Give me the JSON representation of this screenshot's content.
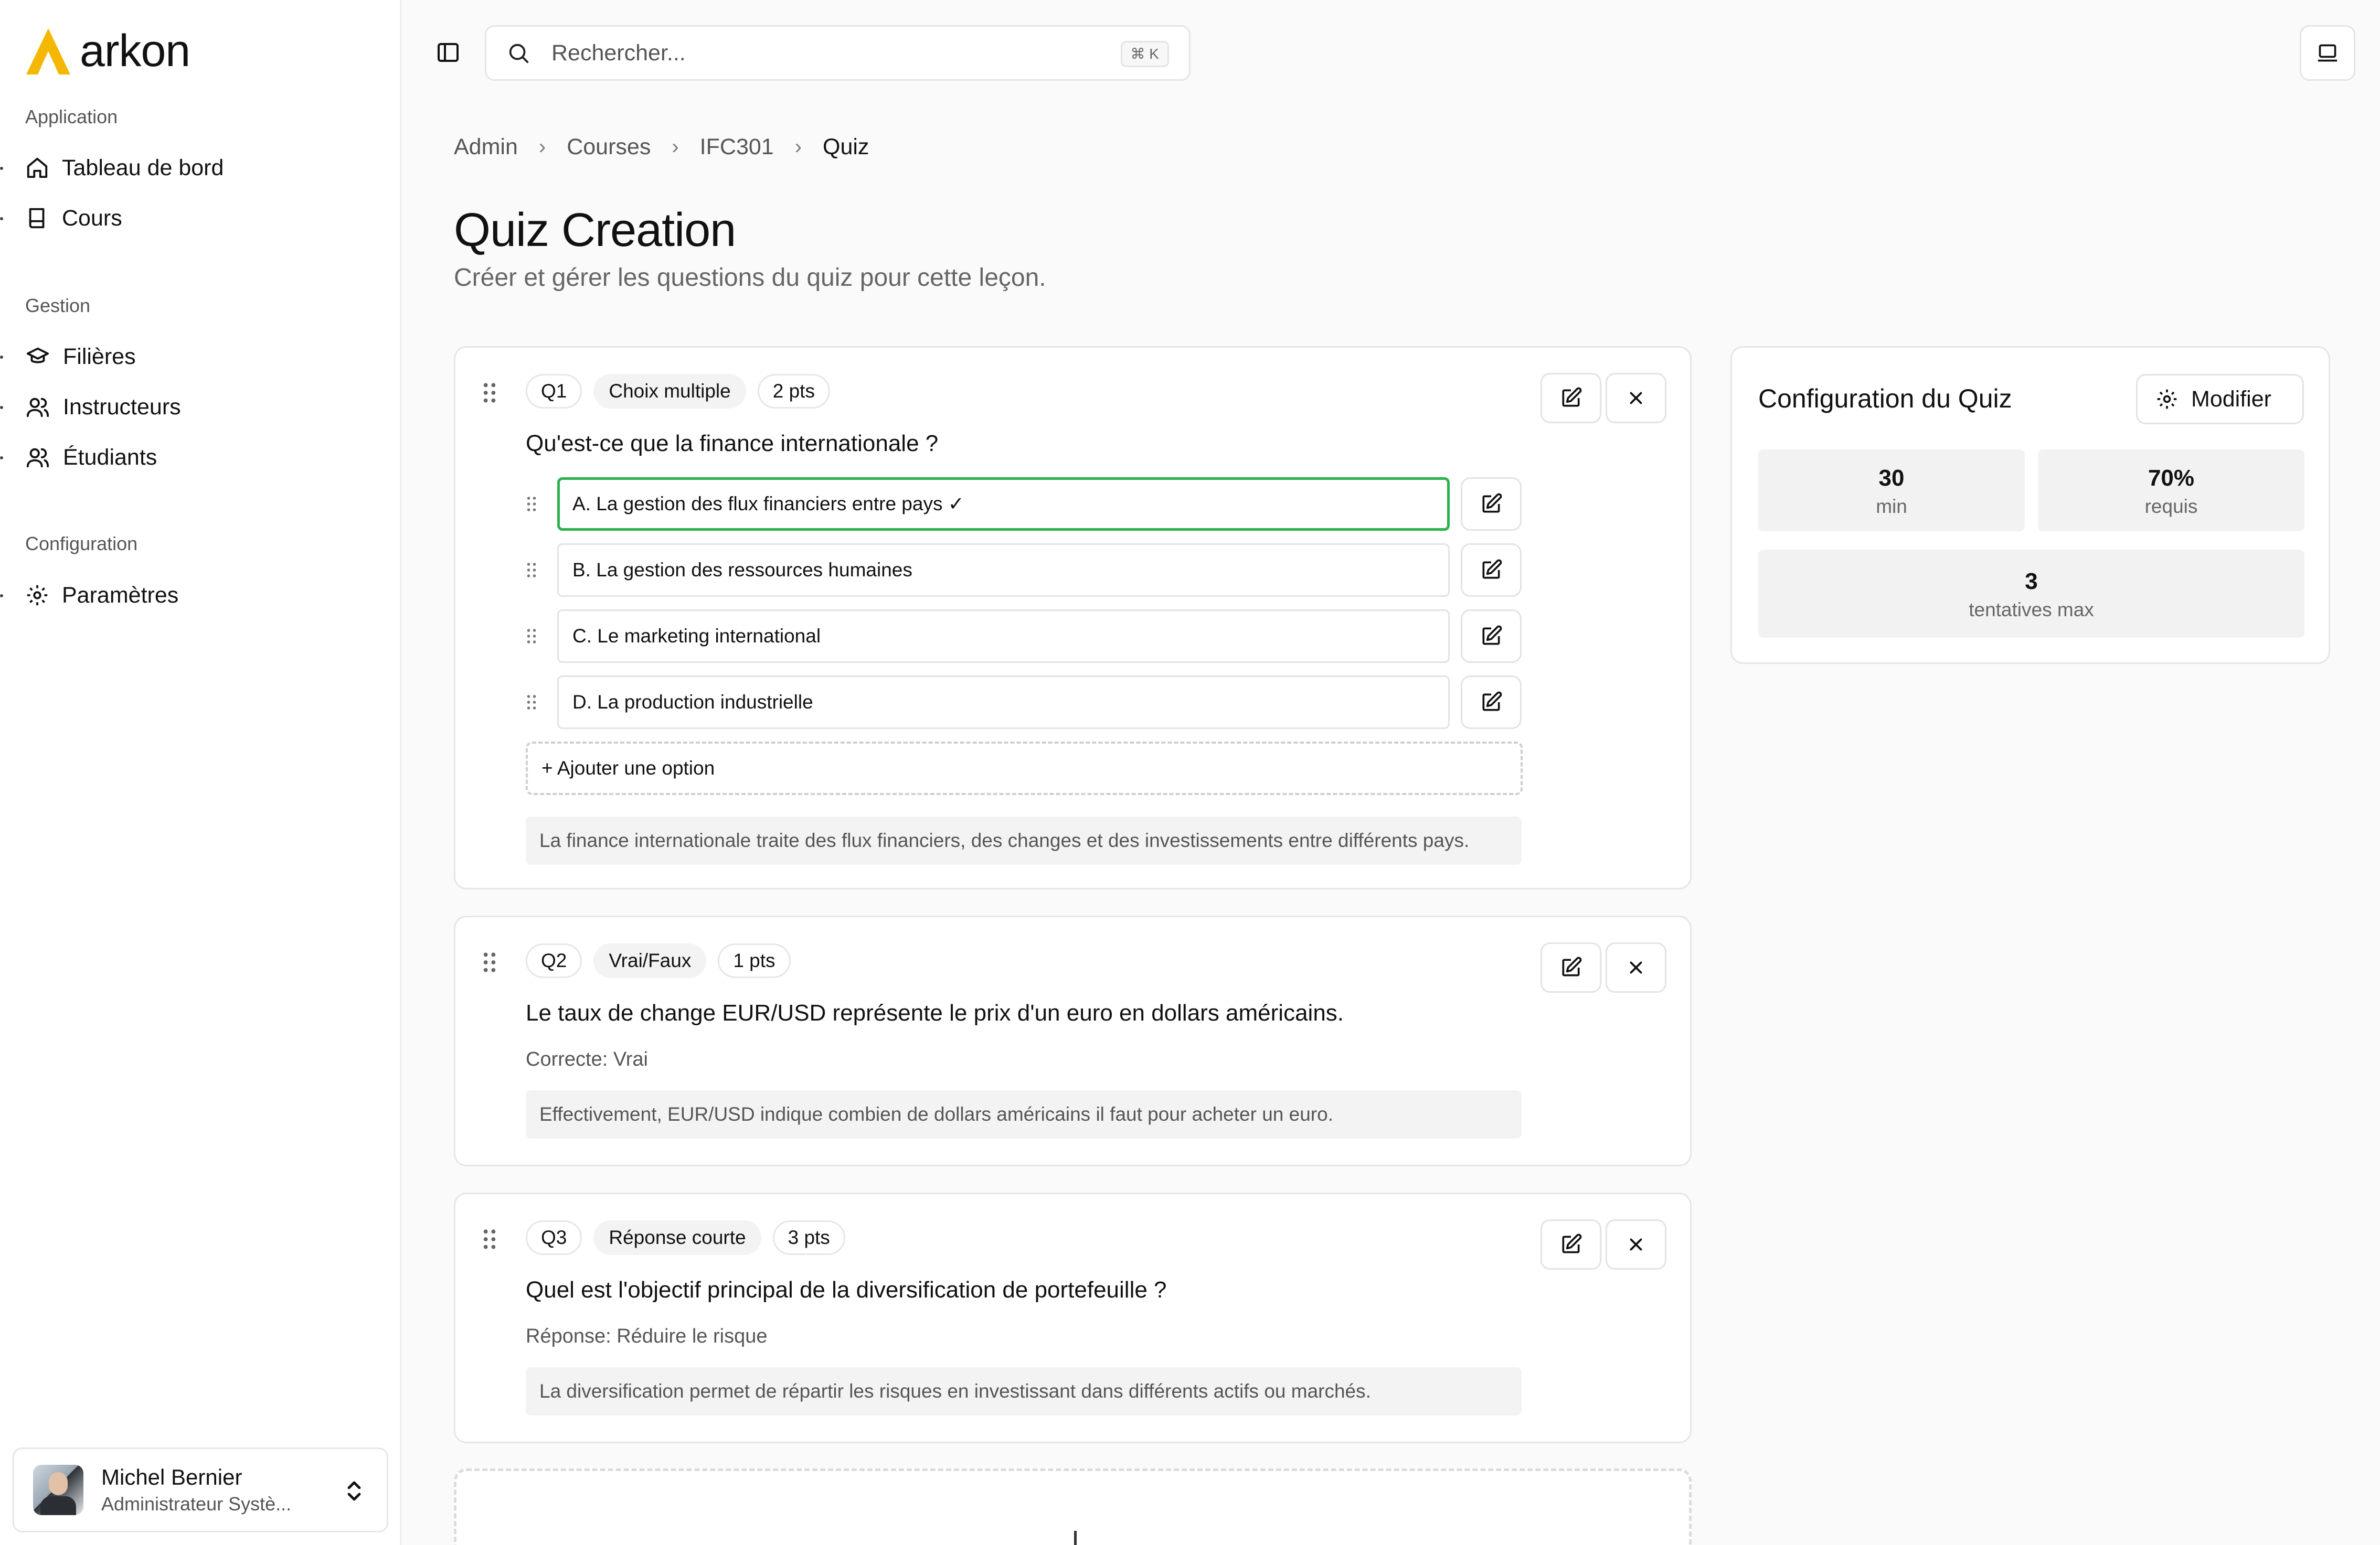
{
  "app": {
    "logo_text": "arkon",
    "brand_color": "#F5B800"
  },
  "sidebar": {
    "sections": [
      {
        "title": "Application",
        "items": [
          {
            "label": "Tableau de bord",
            "icon": "home-icon"
          },
          {
            "label": "Cours",
            "icon": "book-icon"
          }
        ]
      },
      {
        "title": "Gestion",
        "items": [
          {
            "label": "Filières",
            "icon": "graduation-cap-icon"
          },
          {
            "label": "Instructeurs",
            "icon": "users-icon"
          },
          {
            "label": "Étudiants",
            "icon": "users-icon"
          }
        ]
      },
      {
        "title": "Configuration",
        "items": [
          {
            "label": "Paramètres",
            "icon": "gear-icon"
          }
        ]
      }
    ],
    "user": {
      "name": "Michel Bernier",
      "role": "Administrateur Systè..."
    }
  },
  "search": {
    "placeholder": "Rechercher...",
    "shortcut": "⌘ K"
  },
  "breadcrumb": [
    "Admin",
    "Courses",
    "IFC301",
    "Quiz"
  ],
  "page": {
    "title": "Quiz Creation",
    "subtitle": "Créer et gérer les questions du quiz pour cette leçon."
  },
  "questions": [
    {
      "id": "Q1",
      "type": "Choix multiple",
      "points": "2 pts",
      "text": "Qu'est-ce que la finance internationale ?",
      "options": [
        {
          "label": "A. La gestion des flux financiers entre pays ✓",
          "correct": true
        },
        {
          "label": "B. La gestion des ressources humaines",
          "correct": false
        },
        {
          "label": "C. Le marketing international",
          "correct": false
        },
        {
          "label": "D. La production industrielle",
          "correct": false
        }
      ],
      "add_option_label": "+ Ajouter une option",
      "explanation": "La finance internationale traite des flux financiers, des changes et des investissements entre différents pays."
    },
    {
      "id": "Q2",
      "type": "Vrai/Faux",
      "points": "1 pts",
      "text": "Le taux de change EUR/USD représente le prix d'un euro en dollars américains.",
      "answer": "Correcte: Vrai",
      "explanation": "Effectivement, EUR/USD indique combien de dollars américains il faut pour acheter un euro."
    },
    {
      "id": "Q3",
      "type": "Réponse courte",
      "points": "3 pts",
      "text": "Quel est l'objectif principal de la diversification de portefeuille ?",
      "answer": "Réponse: Réduire le risque",
      "explanation": "La diversification permet de répartir les risques en investissant dans différents actifs ou marchés."
    }
  ],
  "config": {
    "title": "Configuration du Quiz",
    "modify_label": "Modifier",
    "duration": {
      "value": "30",
      "unit": "min"
    },
    "pass_score": {
      "value": "70%",
      "unit": "requis"
    },
    "attempts": {
      "value": "3",
      "unit": "tentatives max"
    }
  },
  "colors": {
    "correct_border": "#2BB24C",
    "text": "#111111",
    "muted": "#555555"
  }
}
